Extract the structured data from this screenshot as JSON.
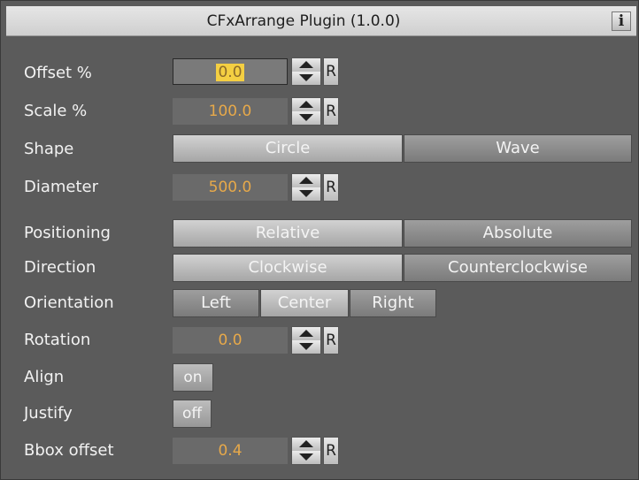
{
  "window": {
    "title": "CFxArrange Plugin (1.0.0)",
    "info_label": "i"
  },
  "rows": {
    "offset": {
      "label": "Offset %",
      "value": "0.0",
      "reset": "R"
    },
    "scale": {
      "label": "Scale %",
      "value": "100.0",
      "reset": "R"
    },
    "shape": {
      "label": "Shape",
      "options": [
        "Circle",
        "Wave"
      ],
      "selected": "Circle"
    },
    "diameter": {
      "label": "Diameter",
      "value": "500.0",
      "reset": "R"
    },
    "positioning": {
      "label": "Positioning",
      "options": [
        "Relative",
        "Absolute"
      ],
      "selected": "Relative"
    },
    "direction": {
      "label": "Direction",
      "options": [
        "Clockwise",
        "Counterclockwise"
      ],
      "selected": "Clockwise"
    },
    "orientation": {
      "label": "Orientation",
      "options": [
        "Left",
        "Center",
        "Right"
      ],
      "selected": "Center"
    },
    "rotation": {
      "label": "Rotation",
      "value": "0.0",
      "reset": "R"
    },
    "align": {
      "label": "Align",
      "state": "on"
    },
    "justify": {
      "label": "Justify",
      "state": "off"
    },
    "bbox": {
      "label": "Bbox offset",
      "value": "0.4",
      "reset": "R"
    }
  },
  "colors": {
    "value_text": "#e7a94a",
    "highlight": "#f4cf42",
    "panel_bg": "#5b5b5b"
  }
}
